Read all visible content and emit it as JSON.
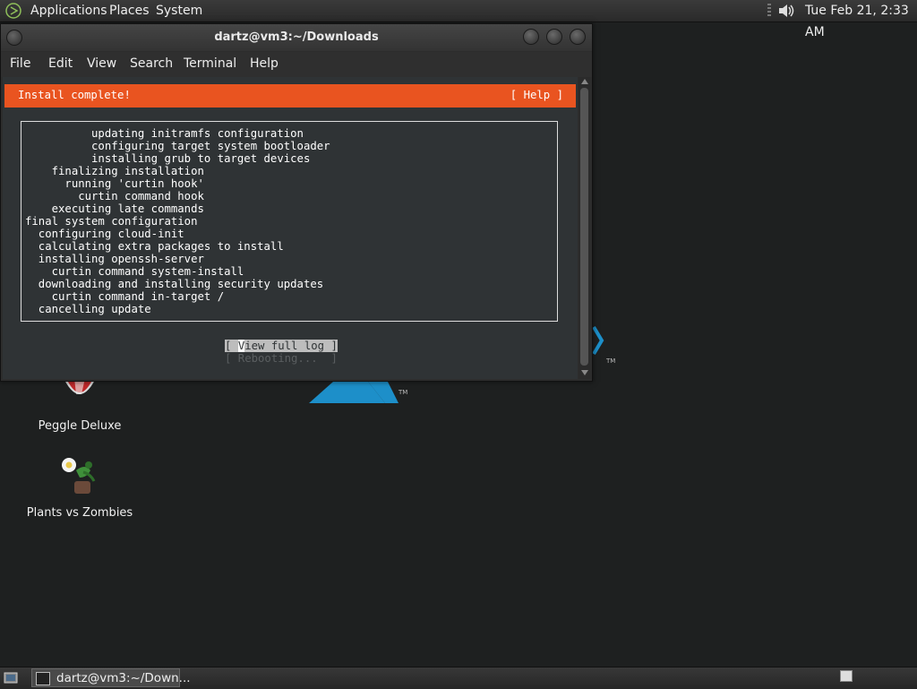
{
  "top_panel": {
    "menus": [
      "Applications",
      "Places",
      "System"
    ],
    "clock": "Tue Feb 21,  2:33 AM"
  },
  "window": {
    "title": "dartz@vm3:~/Downloads",
    "menubar": [
      "File",
      "Edit",
      "View",
      "Search",
      "Terminal",
      "Help"
    ]
  },
  "installer": {
    "header_title": "Install complete!",
    "help_label": "[ Help ]",
    "log_lines": [
      "          updating initramfs configuration",
      "          configuring target system bootloader",
      "          installing grub to target devices",
      "    finalizing installation",
      "      running 'curtin hook'",
      "        curtin command hook",
      "    executing late commands",
      "final system configuration",
      "  configuring cloud-init",
      "  calculating extra packages to install",
      "  installing openssh-server",
      "    curtin command system-install",
      "  downloading and installing security updates",
      "    curtin command in-target /",
      "  cancelling update"
    ],
    "btn_view_prefix": "[ ",
    "btn_view_cursor": "V",
    "btn_view_rest": "iew full log ]",
    "btn_reboot": "[ Rebooting...  ]"
  },
  "desktop_icons": [
    {
      "label": "Peggle Deluxe",
      "icon": "peggle-icon"
    },
    {
      "label": "Plants vs Zombies",
      "icon": "plants-vs-zombies-icon"
    }
  ],
  "taskbar": {
    "task_label": "dartz@vm3:~/Down..."
  },
  "colors": {
    "accent": "#e95420",
    "terminal_bg": "#2f3335",
    "desktop_bg": "#1e2020"
  }
}
